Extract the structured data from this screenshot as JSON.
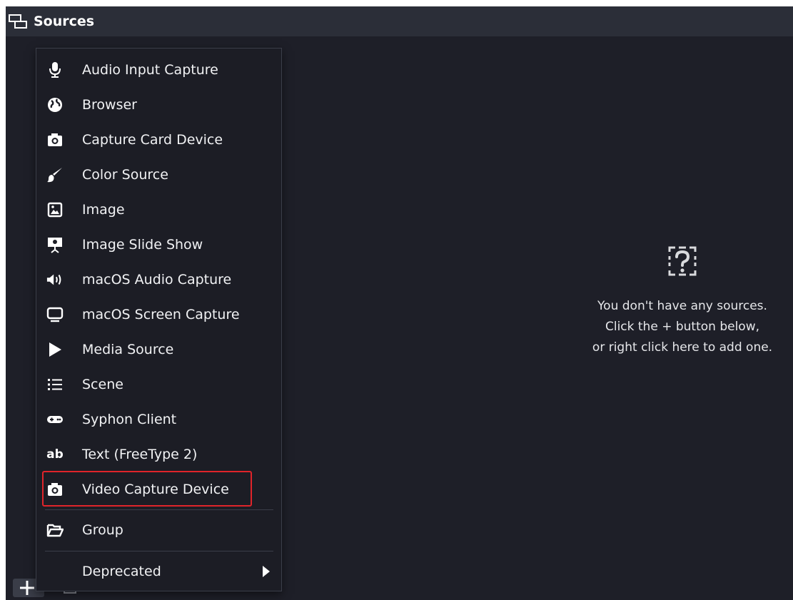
{
  "dock": {
    "title": "Sources",
    "empty_lines": [
      "You don't have any sources.",
      "Click the + button below,",
      "or right click here to add one."
    ]
  },
  "menu": {
    "items": [
      {
        "label": "Audio Input Capture",
        "icon": "microphone-icon"
      },
      {
        "label": "Browser",
        "icon": "globe-icon"
      },
      {
        "label": "Capture Card Device",
        "icon": "camera-icon"
      },
      {
        "label": "Color Source",
        "icon": "paint-brush-icon"
      },
      {
        "label": "Image",
        "icon": "image-icon"
      },
      {
        "label": "Image Slide Show",
        "icon": "slideshow-icon"
      },
      {
        "label": "macOS Audio Capture",
        "icon": "speaker-icon"
      },
      {
        "label": "macOS Screen Capture",
        "icon": "monitor-icon"
      },
      {
        "label": "Media Source",
        "icon": "play-icon"
      },
      {
        "label": "Scene",
        "icon": "list-icon"
      },
      {
        "label": "Syphon Client",
        "icon": "gamepad-icon"
      },
      {
        "label": "Text (FreeType 2)",
        "icon": "text-icon"
      },
      {
        "label": "Video Capture Device",
        "icon": "camera-icon",
        "highlighted": true
      }
    ],
    "group_label": "Group",
    "deprecated_label": "Deprecated",
    "text_icon_glyph": "ab"
  },
  "colors": {
    "dock_background": "#1e1f28",
    "header_background": "#2b2e38",
    "menu_background": "#1c1d25",
    "highlight_border": "#e0242a"
  }
}
